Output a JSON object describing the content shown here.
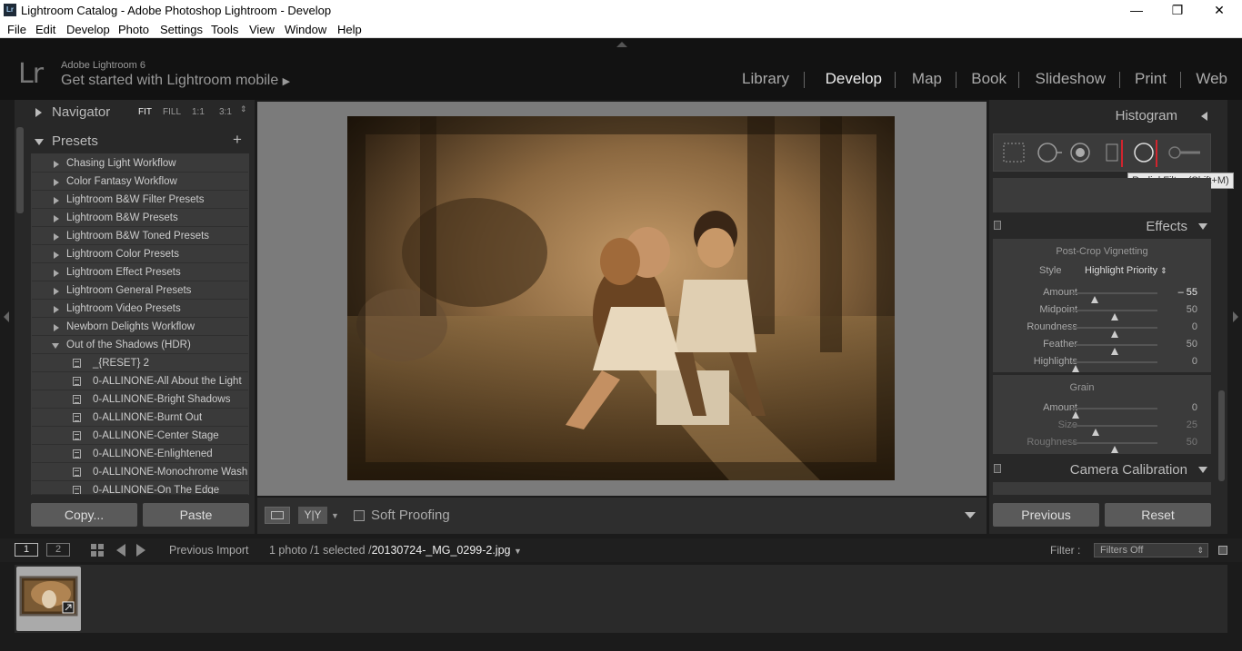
{
  "window": {
    "title": "Lightroom Catalog - Adobe Photoshop Lightroom - Develop",
    "app_icon": "Lr",
    "controls": {
      "minimize": "—",
      "restore": "❐",
      "close": "✕"
    }
  },
  "menu": [
    "File",
    "Edit",
    "Develop",
    "Photo",
    "Settings",
    "Tools",
    "View",
    "Window",
    "Help"
  ],
  "identity": {
    "logo": "Lr",
    "brand": "Adobe Lightroom 6",
    "mobile_prompt": "Get started with Lightroom mobile"
  },
  "modules": [
    "Library",
    "Develop",
    "Map",
    "Book",
    "Slideshow",
    "Print",
    "Web"
  ],
  "active_module": "Develop",
  "navigator": {
    "label": "Navigator",
    "zoom": [
      "FIT",
      "FILL",
      "1:1",
      "3:1"
    ]
  },
  "presets": {
    "label": "Presets",
    "add": "+",
    "folders": [
      "Chasing Light Workflow",
      "Color Fantasy Workflow",
      "Lightroom B&W Filter Presets",
      "Lightroom B&W Presets",
      "Lightroom B&W Toned Presets",
      "Lightroom Color Presets",
      "Lightroom Effect Presets",
      "Lightroom General Presets",
      "Lightroom Video Presets",
      "Newborn Delights Workflow"
    ],
    "open_folder": "Out of the Shadows (HDR)",
    "items": [
      "_{RESET} 2",
      "0-ALLINONE-All About the Light",
      "0-ALLINONE-Bright Shadows",
      "0-ALLINONE-Burnt Out",
      "0-ALLINONE-Center Stage",
      "0-ALLINONE-Enlightened",
      "0-ALLINONE-Monochrome Wash",
      "0-ALLINONE-On The Edge"
    ]
  },
  "left_buttons": {
    "copy": "Copy...",
    "paste": "Paste"
  },
  "toolbar": {
    "soft_proofing": "Soft Proofing",
    "yy": "Y|Y"
  },
  "histogram": {
    "label": "Histogram"
  },
  "tool_tooltip": "Radial Filter (Shift+M)",
  "effects": {
    "label": "Effects",
    "vignette_title": "Post-Crop Vignetting",
    "style_label": "Style",
    "style_value": "Highlight Priority",
    "vignette_sliders": [
      {
        "name": "Amount",
        "value": "– 55",
        "pos": 0.27
      },
      {
        "name": "Midpoint",
        "value": "50",
        "pos": 0.5
      },
      {
        "name": "Roundness",
        "value": "0",
        "pos": 0.5
      },
      {
        "name": "Feather",
        "value": "50",
        "pos": 0.5
      },
      {
        "name": "Highlights",
        "value": "0",
        "pos": 0.05
      }
    ],
    "grain_title": "Grain",
    "grain_sliders": [
      {
        "name": "Amount",
        "value": "0",
        "pos": 0.05
      },
      {
        "name": "Size",
        "value": "25",
        "pos": 0.28
      },
      {
        "name": "Roughness",
        "value": "50",
        "pos": 0.5
      }
    ]
  },
  "camera_calibration": {
    "label": "Camera Calibration"
  },
  "right_buttons": {
    "previous": "Previous",
    "reset": "Reset"
  },
  "filmstrip": {
    "view1": "1",
    "view2": "2",
    "source": "Previous Import",
    "count": "1 photo /1 selected /",
    "filename": "20130724-_MG_0299-2.jpg",
    "filter_label": "Filter :",
    "filter_value": "Filters Off"
  },
  "colors": {
    "accent_red": "#d0242e",
    "panel_bg": "#282828",
    "canvas_bg": "#7b7b7b"
  }
}
